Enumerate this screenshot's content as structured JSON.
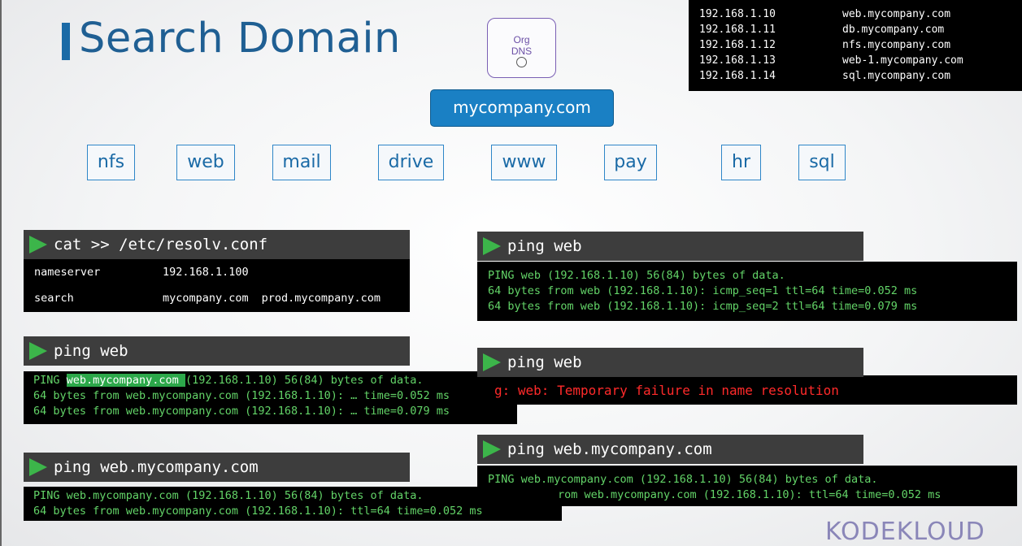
{
  "title": "Search Domain",
  "org_dns": {
    "line1": "Org",
    "line2": "DNS"
  },
  "hosts": [
    {
      "ip": "192.168.1.10",
      "name": "web.mycompany.com"
    },
    {
      "ip": "192.168.1.11",
      "name": "db.mycompany.com"
    },
    {
      "ip": "192.168.1.12",
      "name": "nfs.mycompany.com"
    },
    {
      "ip": "192.168.1.13",
      "name": "web-1.mycompany.com"
    },
    {
      "ip": "192.168.1.14",
      "name": "sql.mycompany.com"
    }
  ],
  "domain": "mycompany.com",
  "subdomains": [
    "nfs",
    "web",
    "mail",
    "drive",
    "www",
    "pay",
    "hr",
    "sql"
  ],
  "resolv": {
    "command": "cat >> /etc/resolv.conf",
    "nameserver_key": "nameserver",
    "nameserver_value": "192.168.1.100",
    "search_key": "search",
    "search_value1": "mycompany.com",
    "search_value2": "prod.mycompany.com"
  },
  "ping_left_1": {
    "command": "ping web",
    "l1_pre": "PING ",
    "l1_hl": "web.mycompany.com ",
    "l1_post": "(192.168.1.10) 56(84) bytes of data.",
    "l2": "64 bytes from web.mycompany.com (192.168.1.10): … time=0.052 ms",
    "l3": "64 bytes from web.mycompany.com (192.168.1.10): … time=0.079 ms"
  },
  "ping_left_2": {
    "command": "ping web.mycompany.com",
    "l1": "PING web.mycompany.com (192.168.1.10) 56(84) bytes of data.",
    "l2": "64 bytes from web.mycompany.com (192.168.1.10): ttl=64 time=0.052 ms"
  },
  "ping_right_1": {
    "command": "ping web",
    "l1": "PING web (192.168.1.10) 56(84) bytes of data.",
    "l2": "64 bytes from web (192.168.1.10): icmp_seq=1 ttl=64 time=0.052 ms",
    "l3": "64 bytes from web (192.168.1.10): icmp_seq=2 ttl=64 time=0.079 ms"
  },
  "ping_right_2": {
    "command": "ping web",
    "err": "g: web: Temporary failure in name resolution"
  },
  "ping_right_3": {
    "command": "ping web.mycompany.com",
    "l1": "PING web.mycompany.com (192.168.1.10) 56(84) bytes of data.",
    "l2": "rom web.mycompany.com (192.168.1.10): ttl=64 time=0.052 ms"
  },
  "logo": "KODEKLOUD",
  "colors": {
    "title": "#1f5f93",
    "domain_bg": "#1a80c4",
    "terminal_text": "#63d468",
    "error_text": "#ff2a2a",
    "prompt_arrow": "#3cb54a"
  }
}
